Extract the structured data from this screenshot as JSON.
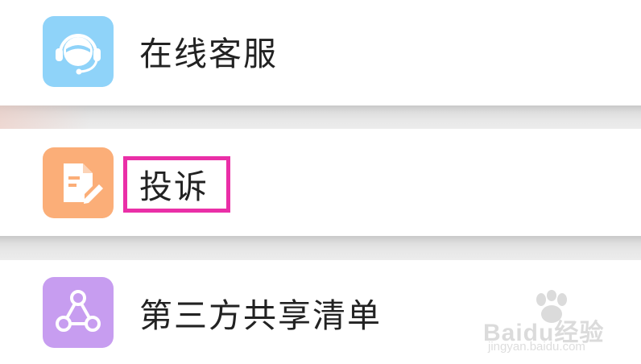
{
  "menu": {
    "items": [
      {
        "label": "在线客服",
        "icon": "customer-service-headset-icon",
        "icon_color": "#8fd3f9"
      },
      {
        "label": "投诉",
        "icon": "complaint-document-pen-icon",
        "icon_color": "#fbae78",
        "highlighted": true,
        "highlight_color": "#ea2fa7"
      },
      {
        "label": "第三方共享清单",
        "icon": "share-network-icon",
        "icon_color": "#c79df0"
      }
    ]
  },
  "watermark": {
    "logo": "Baidu经验",
    "url": "jingyan.baidu.com"
  }
}
